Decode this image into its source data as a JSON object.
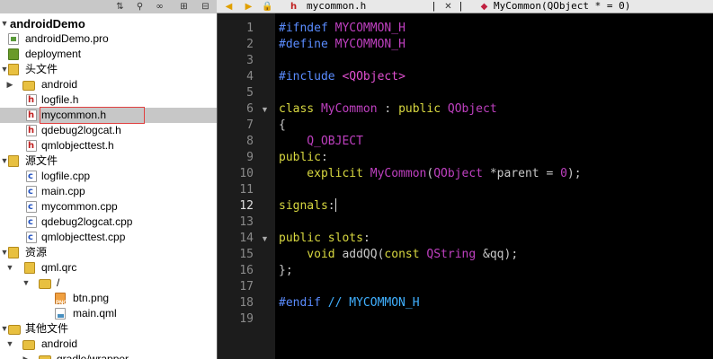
{
  "tabs": {
    "file_tab": "mycommon.h",
    "symbol_tab": "MyCommon(QObject * = 0)",
    "lock": "🔒",
    "close": "✕",
    "sep": "|"
  },
  "tree": {
    "root": "androidDemo",
    "items": [
      "androidDemo.pro",
      "deployment",
      "头文件",
      "android",
      "logfile.h",
      "mycommon.h",
      "qdebug2logcat.h",
      "qmlobjecttest.h",
      "源文件",
      "logfile.cpp",
      "main.cpp",
      "mycommon.cpp",
      "qdebug2logcat.cpp",
      "qmlobjecttest.cpp",
      "资源",
      "qml.qrc",
      "/",
      "btn.png",
      "main.qml",
      "其他文件",
      "android",
      "gradle/wrapper"
    ]
  },
  "editor": {
    "line_numbers": [
      "1",
      "2",
      "3",
      "4",
      "5",
      "6",
      "7",
      "8",
      "9",
      "10",
      "11",
      "12",
      "13",
      "14",
      "15",
      "16",
      "17",
      "18",
      "19"
    ],
    "current_line": 12,
    "fold_markers": [
      "▼",
      "▼"
    ]
  },
  "code": {
    "l1_a": "#ifndef",
    "l1_b": " MYCOMMON_H",
    "l2_a": "#define",
    "l2_b": " MYCOMMON_H",
    "l4_a": "#include",
    "l4_b": " <QObject>",
    "l6_a": "class",
    "l6_b": " MyCommon",
    "l6_c": " : ",
    "l6_d": "public",
    "l6_e": " QObject",
    "l7": "{",
    "l8": "    Q_OBJECT",
    "l9_a": "public",
    "l9_b": ":",
    "l10_a": "    explicit",
    "l10_b": " MyCommon",
    "l10_c": "(",
    "l10_d": "QObject",
    "l10_e": " *parent = ",
    "l10_f": "0",
    "l10_g": ");",
    "l12_a": "signals",
    "l12_b": ":",
    "l14_a": "public",
    "l14_b": " slots",
    "l14_c": ":",
    "l15_a": "    void",
    "l15_b": " addQQ(",
    "l15_c": "const",
    "l15_d": " QString",
    "l15_e": " &qq);",
    "l16": "};",
    "l18_a": "#endif",
    "l18_b": " // MYCOMMON_H"
  }
}
